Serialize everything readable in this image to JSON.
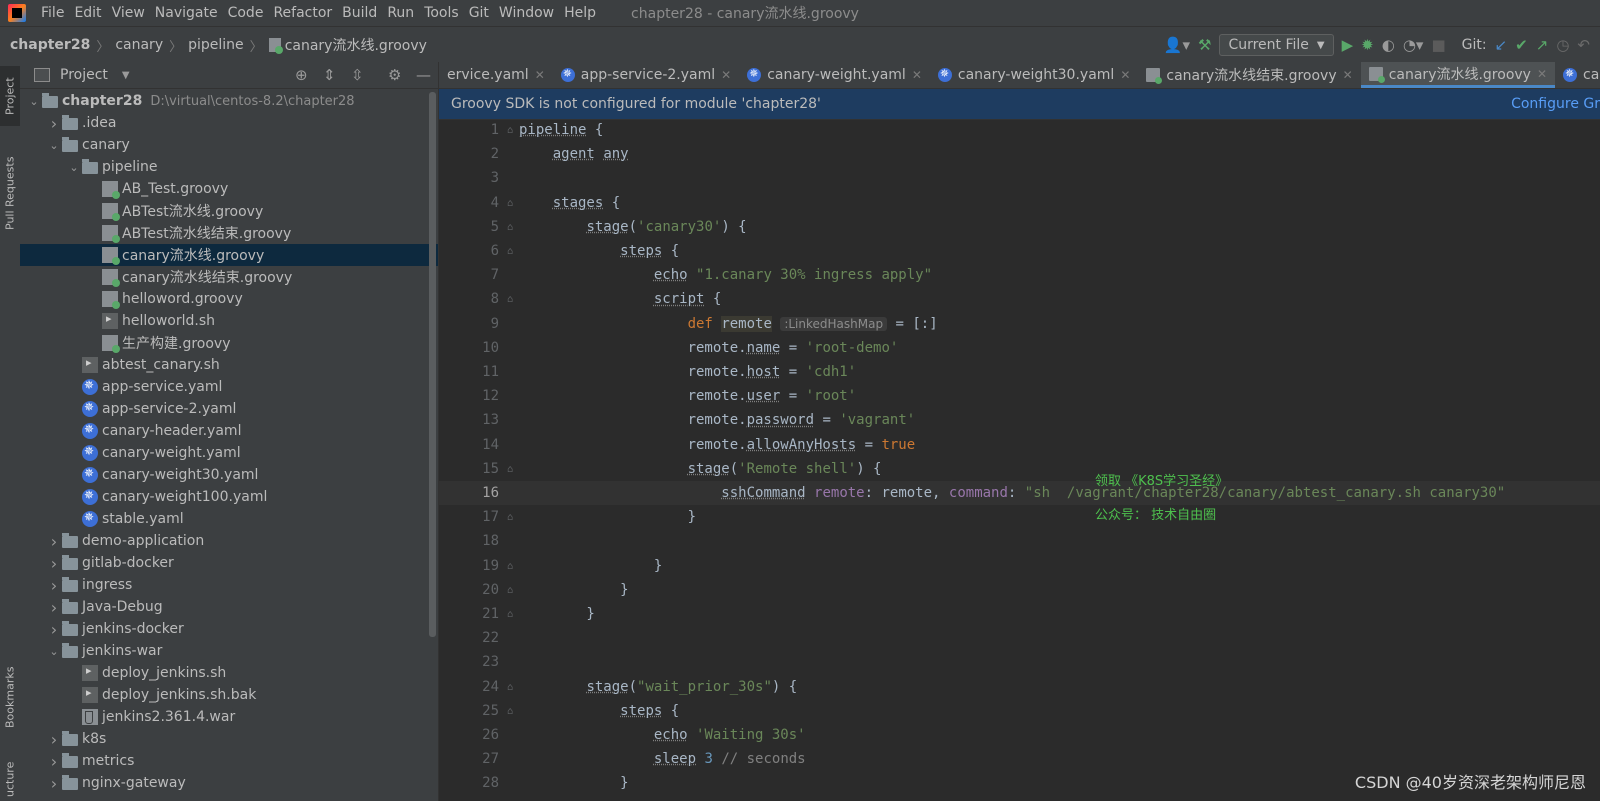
{
  "menubar": {
    "items": [
      "File",
      "Edit",
      "View",
      "Navigate",
      "Code",
      "Refactor",
      "Build",
      "Run",
      "Tools",
      "Git",
      "Window",
      "Help"
    ],
    "window_title": "chapter28 - canary流水线.groovy"
  },
  "breadcrumb": [
    "chapter28",
    "canary",
    "pipeline",
    "canary流水线.groovy"
  ],
  "toolbar": {
    "run_config": "Current File",
    "git_label": "Git:"
  },
  "sidestrip": {
    "project": "Project",
    "pull_requests": "Pull Requests",
    "bookmarks": "Bookmarks",
    "structure": "ucture"
  },
  "project_panel": {
    "title": "Project",
    "root": {
      "name": "chapter28",
      "path": "D:\\virtual\\centos-8.2\\chapter28"
    },
    "tree": [
      {
        "label": ".idea",
        "type": "folder",
        "depth": 1,
        "expand": "closed"
      },
      {
        "label": "canary",
        "type": "folder",
        "depth": 1,
        "expand": "open"
      },
      {
        "label": "pipeline",
        "type": "folder",
        "depth": 2,
        "expand": "open"
      },
      {
        "label": "AB_Test.groovy",
        "type": "groovy",
        "depth": 3
      },
      {
        "label": "ABTest流水线.groovy",
        "type": "groovy",
        "depth": 3
      },
      {
        "label": "ABTest流水线结束.groovy",
        "type": "groovy",
        "depth": 3
      },
      {
        "label": "canary流水线.groovy",
        "type": "groovy",
        "depth": 3,
        "selected": true
      },
      {
        "label": "canary流水线结束.groovy",
        "type": "groovy",
        "depth": 3
      },
      {
        "label": "helloword.groovy",
        "type": "groovy",
        "depth": 3
      },
      {
        "label": "helloworld.sh",
        "type": "shell",
        "depth": 3
      },
      {
        "label": "生产构建.groovy",
        "type": "groovy",
        "depth": 3
      },
      {
        "label": "abtest_canary.sh",
        "type": "shell",
        "depth": 2
      },
      {
        "label": "app-service.yaml",
        "type": "k8s",
        "depth": 2
      },
      {
        "label": "app-service-2.yaml",
        "type": "k8s",
        "depth": 2
      },
      {
        "label": "canary-header.yaml",
        "type": "k8s",
        "depth": 2
      },
      {
        "label": "canary-weight.yaml",
        "type": "k8s",
        "depth": 2
      },
      {
        "label": "canary-weight30.yaml",
        "type": "k8s",
        "depth": 2
      },
      {
        "label": "canary-weight100.yaml",
        "type": "k8s",
        "depth": 2
      },
      {
        "label": "stable.yaml",
        "type": "k8s",
        "depth": 2
      },
      {
        "label": "demo-application",
        "type": "folder",
        "depth": 1,
        "expand": "closed"
      },
      {
        "label": "gitlab-docker",
        "type": "folder",
        "depth": 1,
        "expand": "closed"
      },
      {
        "label": "ingress",
        "type": "folder",
        "depth": 1,
        "expand": "closed"
      },
      {
        "label": "Java-Debug",
        "type": "folder",
        "depth": 1,
        "expand": "closed"
      },
      {
        "label": "jenkins-docker",
        "type": "folder",
        "depth": 1,
        "expand": "closed"
      },
      {
        "label": "jenkins-war",
        "type": "folder",
        "depth": 1,
        "expand": "open"
      },
      {
        "label": "deploy_jenkins.sh",
        "type": "shell",
        "depth": 2
      },
      {
        "label": "deploy_jenkins.sh.bak",
        "type": "shell",
        "depth": 2
      },
      {
        "label": "jenkins2.361.4.war",
        "type": "war",
        "depth": 2
      },
      {
        "label": "k8s",
        "type": "folder",
        "depth": 1,
        "expand": "closed"
      },
      {
        "label": "metrics",
        "type": "folder",
        "depth": 1,
        "expand": "closed"
      },
      {
        "label": "nginx-gateway",
        "type": "folder",
        "depth": 1,
        "expand": "closed"
      }
    ]
  },
  "editor": {
    "tabs": [
      {
        "label": "ervice.yaml",
        "type": "k8s"
      },
      {
        "label": "app-service-2.yaml",
        "type": "k8s"
      },
      {
        "label": "canary-weight.yaml",
        "type": "k8s"
      },
      {
        "label": "canary-weight30.yaml",
        "type": "k8s"
      },
      {
        "label": "canary流水线结束.groovy",
        "type": "groovy"
      },
      {
        "label": "canary流水线.groovy",
        "type": "groovy",
        "active": true
      },
      {
        "label": "canary-w",
        "type": "k8s"
      }
    ],
    "banner": {
      "message": "Groovy SDK is not configured for module 'chapter28'",
      "link": "Configure Gr"
    },
    "current_line": 16,
    "inlay_hint": ":LinkedHashMap",
    "overlay": {
      "line1": "领取 《K8S学习圣经》",
      "line2": "公众号： 技术自由圈"
    }
  },
  "watermark": "CSDN @40岁资深老架构师尼恩",
  "colors": {
    "keyword": "#cc7832",
    "string": "#6a8759",
    "accent": "#4a88c7",
    "selection": "#0d293e"
  }
}
